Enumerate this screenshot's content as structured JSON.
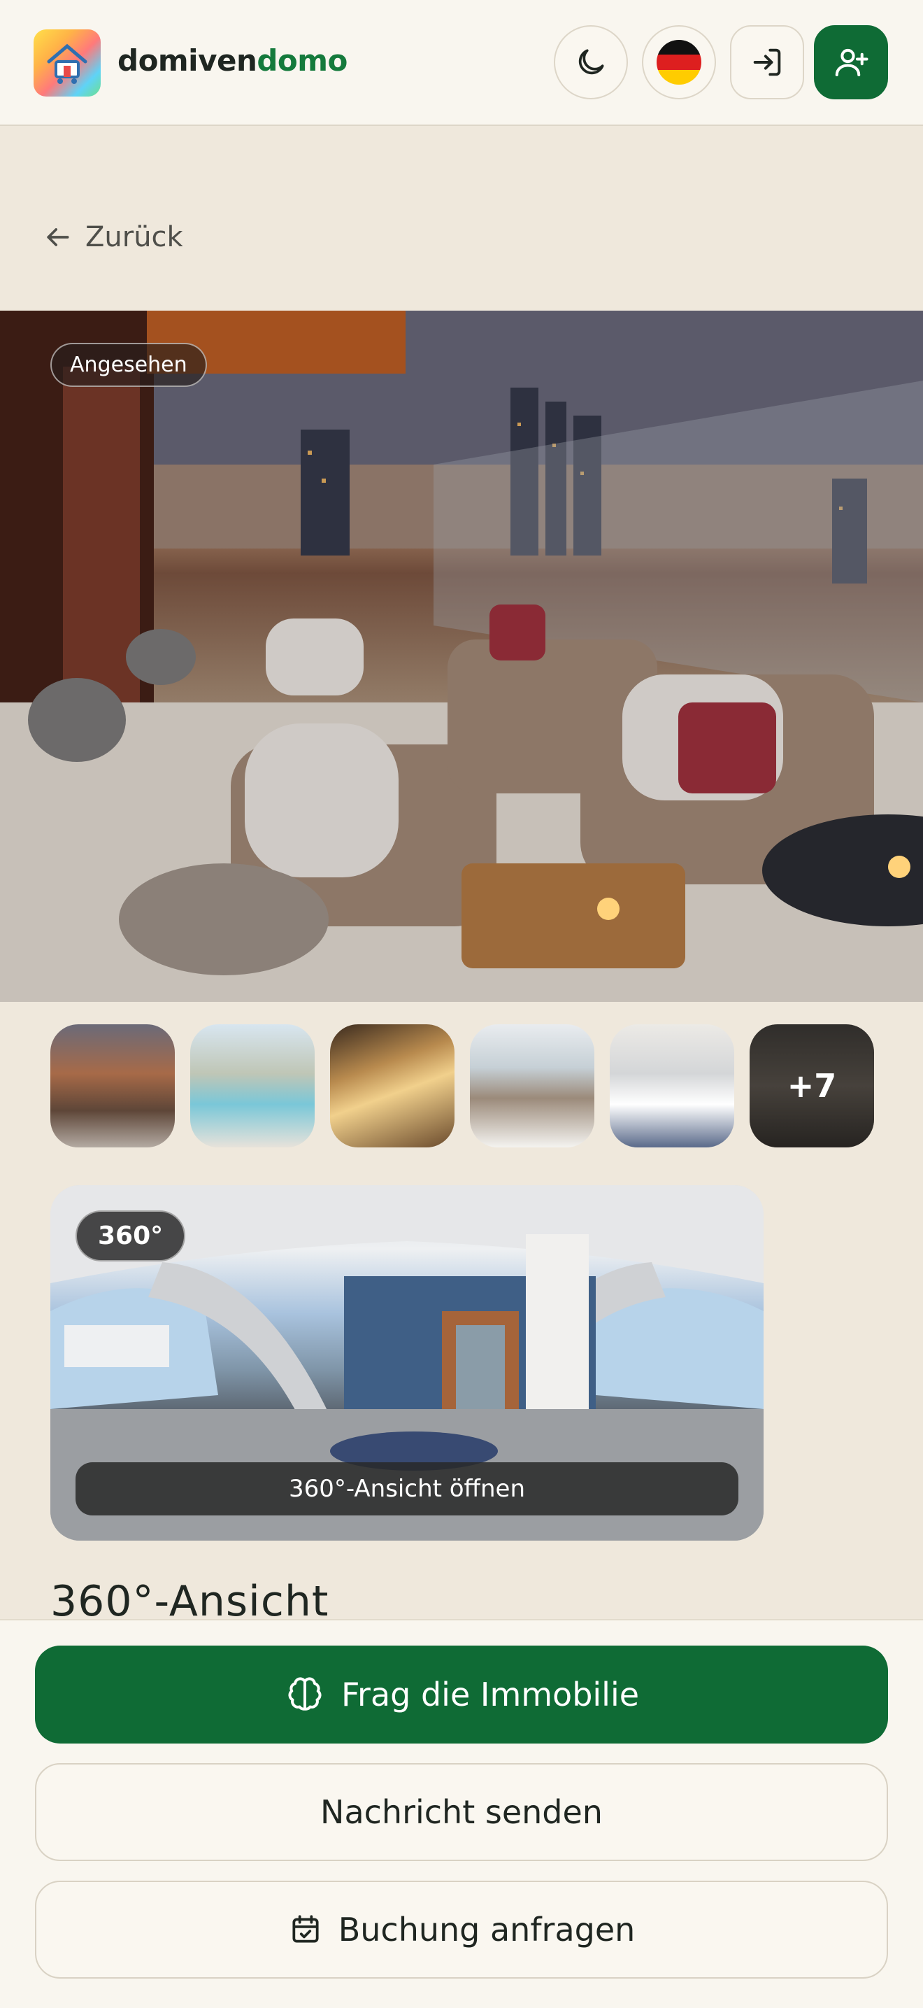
{
  "header": {
    "brand_part1": "domiven",
    "brand_part2": "domo",
    "icons": [
      "moon-icon",
      "german-flag-icon",
      "login-icon",
      "add-user-icon"
    ]
  },
  "nav": {
    "back_label": "Zurück"
  },
  "gallery": {
    "viewed_badge": "Angesehen",
    "more_count": "+7"
  },
  "panorama": {
    "badge": "360°",
    "open_label": "360°-Ansicht öffnen"
  },
  "section": {
    "title": "360°-Ansicht"
  },
  "actions": {
    "ask_property": "Frag die Immobilie",
    "send_message": "Nachricht senden",
    "request_booking": "Buchung anfragen"
  },
  "colors": {
    "brand_green": "#0f6b35",
    "background": "#efe8dc",
    "header_bg": "#f9f6ef"
  }
}
